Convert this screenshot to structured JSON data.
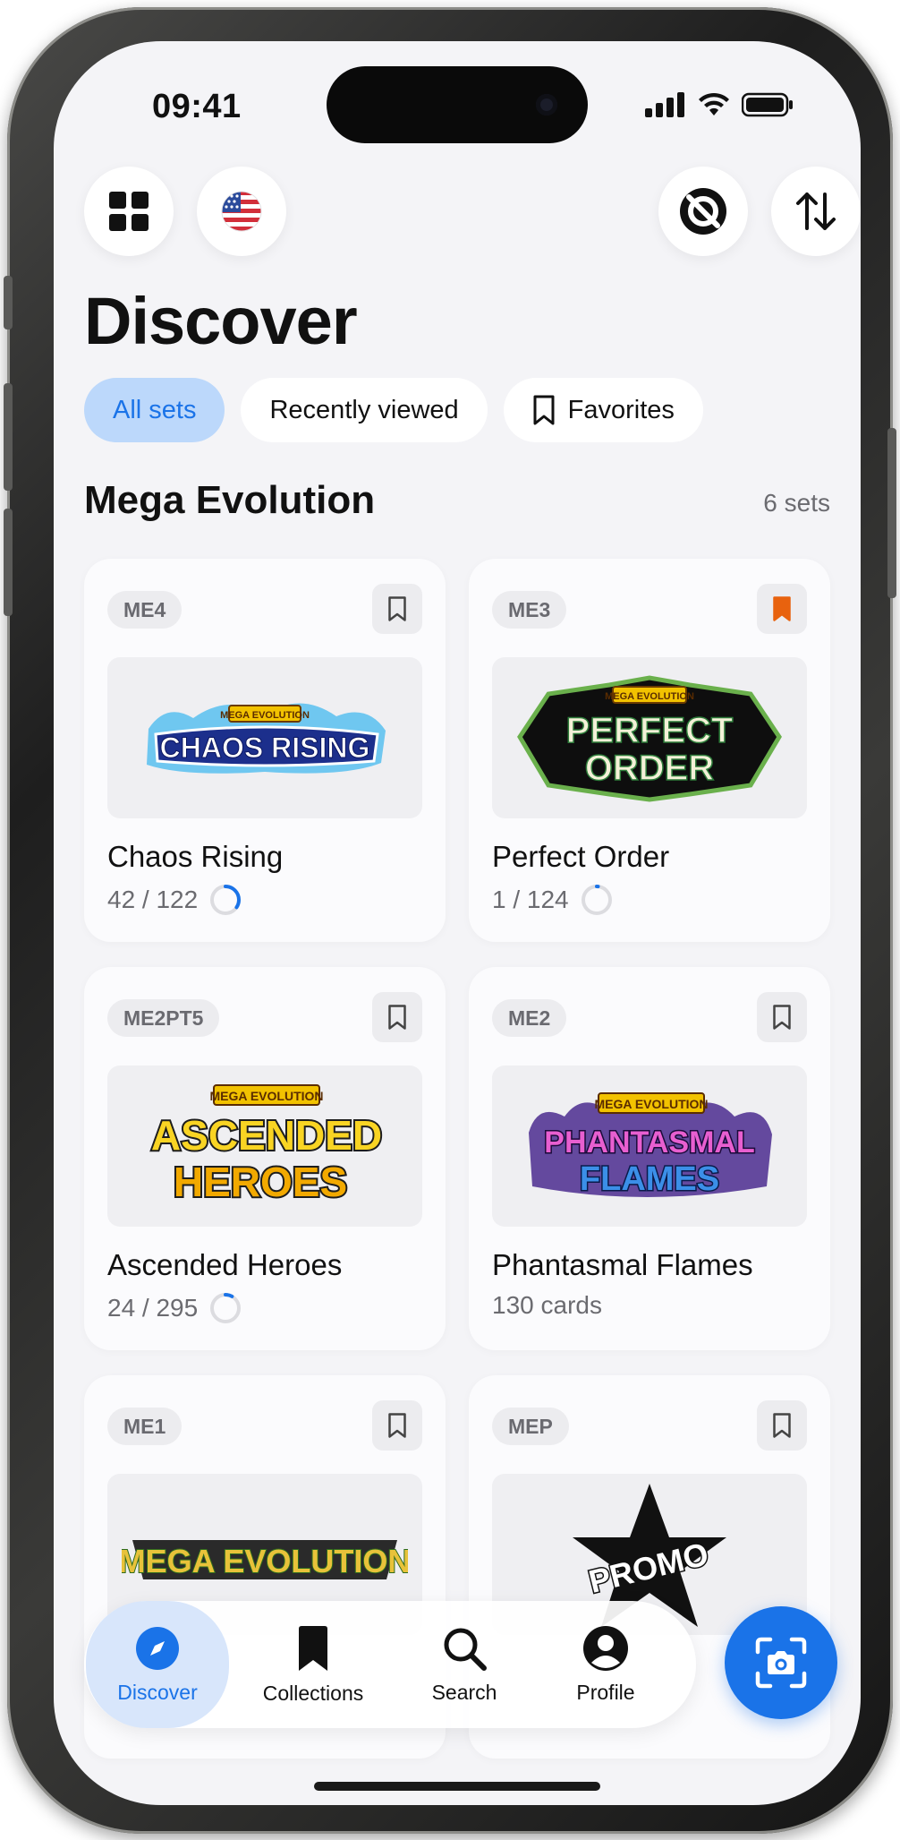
{
  "status_bar": {
    "time": "09:41"
  },
  "page": {
    "title": "Discover"
  },
  "filters": {
    "chips": [
      {
        "label": "All sets",
        "active": true
      },
      {
        "label": "Recently viewed",
        "active": false
      },
      {
        "label": "Favorites",
        "active": false,
        "icon": "bookmark-outline-icon"
      }
    ]
  },
  "section": {
    "title": "Mega Evolution",
    "count": "6 sets"
  },
  "sets": [
    {
      "code": "ME4",
      "name": "Chaos Rising",
      "meta": "42 / 122",
      "progress": 0.344,
      "favorited": false,
      "logo_lines": [
        "MEGA EVOLUTION",
        "CHAOS RISING"
      ]
    },
    {
      "code": "ME3",
      "name": "Perfect Order",
      "meta": "1 / 124",
      "progress": 0.008,
      "favorited": true,
      "logo_lines": [
        "MEGA EVOLUTION",
        "PERFECT",
        "ORDER"
      ]
    },
    {
      "code": "ME2PT5",
      "name": "Ascended Heroes",
      "meta": "24 / 295",
      "progress": 0.081,
      "favorited": false,
      "logo_lines": [
        "MEGA EVOLUTION",
        "ASCENDED",
        "HEROES"
      ]
    },
    {
      "code": "ME2",
      "name": "Phantasmal Flames",
      "meta": "130 cards",
      "progress": null,
      "favorited": false,
      "logo_lines": [
        "MEGA EVOLUTION",
        "PHANTASMAL",
        "FLAMES"
      ]
    },
    {
      "code": "ME1",
      "name": "",
      "meta": "",
      "progress": null,
      "favorited": false,
      "logo_lines": [
        "MEGA EVOLUTION"
      ]
    },
    {
      "code": "MEP",
      "name": "",
      "meta": "",
      "progress": null,
      "favorited": false,
      "logo_lines": [
        "PROMO"
      ]
    }
  ],
  "tabbar": {
    "tabs": [
      {
        "label": "Discover",
        "icon": "compass-icon",
        "active": true
      },
      {
        "label": "Collections",
        "icon": "bookmark-filled-icon",
        "active": false
      },
      {
        "label": "Search",
        "icon": "search-icon",
        "active": false
      },
      {
        "label": "Profile",
        "icon": "profile-icon",
        "active": false
      }
    ],
    "fab_icon": "scan-camera-icon"
  },
  "colors": {
    "accent": "#1a73e8",
    "accent_light": "#bcd8fb",
    "favorite": "#e8620e",
    "background": "#f4f4f7"
  }
}
